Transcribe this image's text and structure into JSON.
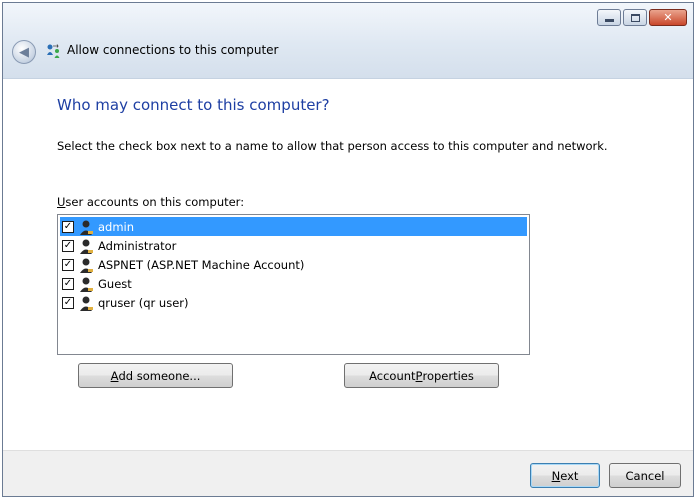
{
  "window": {
    "title": "Allow connections to this computer",
    "caption": {
      "minimize": "minimize",
      "maximize": "maximize",
      "close": "close"
    }
  },
  "heading": "Who may connect to this computer?",
  "description": "Select the check box next to a name to allow that person access to this computer and network.",
  "list": {
    "label_accel": "U",
    "label_rest": "ser accounts on this computer:",
    "items": [
      {
        "label": "admin",
        "checked": true,
        "selected": true
      },
      {
        "label": "Administrator",
        "checked": true,
        "selected": false
      },
      {
        "label": "ASPNET (ASP.NET Machine Account)",
        "checked": true,
        "selected": false
      },
      {
        "label": "Guest",
        "checked": true,
        "selected": false
      },
      {
        "label": "qruser (qr user)",
        "checked": true,
        "selected": false
      }
    ]
  },
  "buttons": {
    "add_accel": "A",
    "add_rest": "dd someone...",
    "props_pre": "Account ",
    "props_accel": "P",
    "props_rest": "roperties",
    "next_accel": "N",
    "next_rest": "ext",
    "cancel": "Cancel"
  },
  "colors": {
    "heading": "#1e3fa3",
    "selection": "#3399ff"
  },
  "icons": {
    "back": "back-arrow-icon",
    "wizard": "network-connection-icon",
    "user": "user-account-icon"
  }
}
